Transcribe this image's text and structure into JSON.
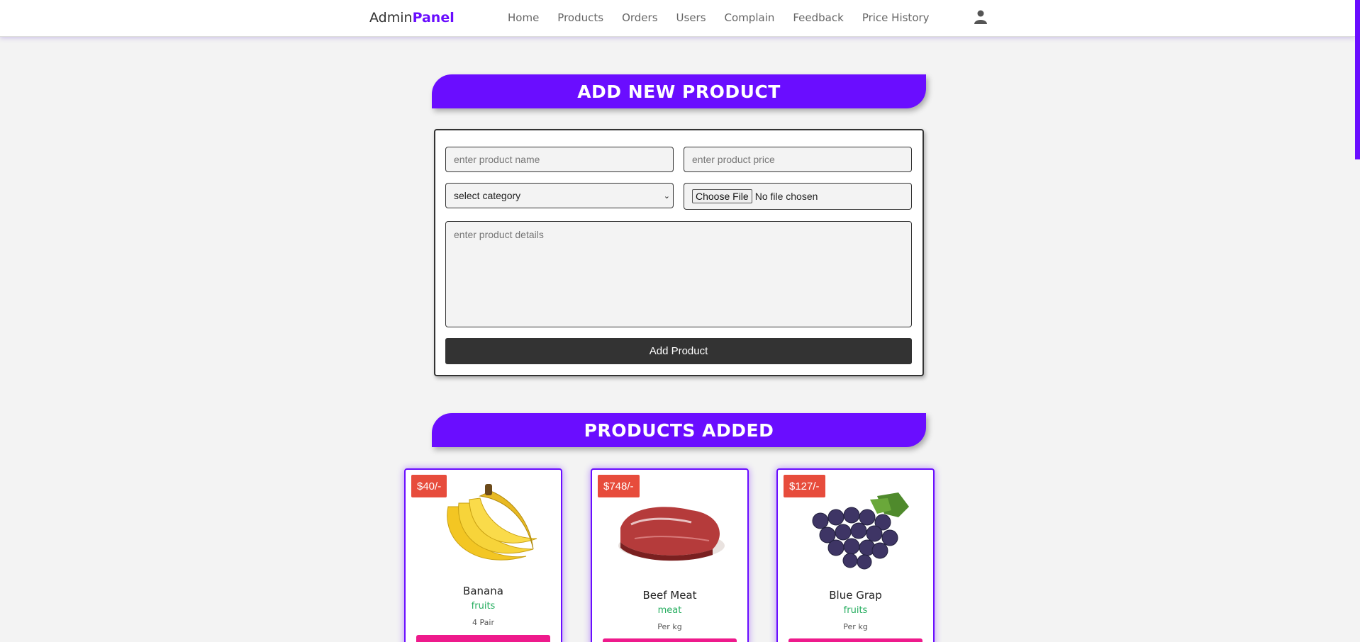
{
  "header": {
    "logo_prefix": "Admin",
    "logo_accent": "Panel",
    "nav": [
      "Home",
      "Products",
      "Orders",
      "Users",
      "Complain",
      "Feedback",
      "Price History"
    ],
    "user_icon": "user-icon"
  },
  "colors": {
    "accent": "#6a0dff",
    "price_tag": "#e74c3c",
    "category": "#27ae60",
    "card_button": "#ee1a8c"
  },
  "add_section": {
    "title": "ADD NEW PRODUCT",
    "name_placeholder": "enter product name",
    "price_placeholder": "enter product price",
    "category_selected": "select category",
    "file_button": "Choose File",
    "file_status": "No file chosen",
    "details_placeholder": "enter product details",
    "submit_label": "Add Product"
  },
  "products_section": {
    "title": "PRODUCTS ADDED",
    "products": [
      {
        "price": "$40/-",
        "name": "Banana",
        "category": "fruits",
        "unit": "4 Pair",
        "image": "banana-image"
      },
      {
        "price": "$748/-",
        "name": "Beef Meat",
        "category": "meat",
        "unit": "Per kg",
        "image": "beef-image"
      },
      {
        "price": "$127/-",
        "name": "Blue Grap",
        "category": "fruits",
        "unit": "Per kg",
        "image": "grapes-image"
      }
    ]
  }
}
